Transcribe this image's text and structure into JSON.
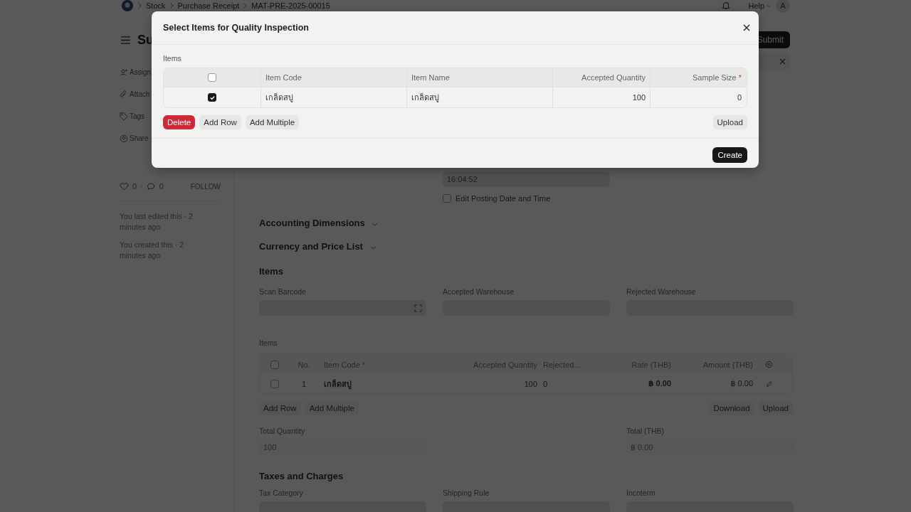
{
  "topbar": {
    "breadcrumbs": [
      "Stock",
      "Purchase Receipt",
      "MAT-PRE-2025-00015"
    ],
    "help": "Help",
    "avatar": "A"
  },
  "header": {
    "title": "Su",
    "submit": "Submit"
  },
  "sidebar": {
    "actions": [
      "Assign",
      "Attach",
      "Tags",
      "Share"
    ],
    "likes": "0",
    "separator": "·",
    "comments": "0",
    "follow": "FOLLOW",
    "activity": [
      "You last edited this · 2 minutes ago",
      "You created this · 2 minutes ago"
    ]
  },
  "form": {
    "posting_time": "16:04:52",
    "edit_posting": {
      "label": "Edit Posting Date and Time",
      "checked": false
    },
    "collapsed_sections": [
      "Accounting Dimensions",
      "Currency and Price List"
    ],
    "items_section": {
      "title": "Items",
      "fields": [
        {
          "label": "Scan Barcode",
          "kind": "barcode"
        },
        {
          "label": "Accepted Warehouse",
          "kind": "link"
        },
        {
          "label": "Rejected Warehouse",
          "kind": "link"
        }
      ],
      "table": {
        "label": "Items",
        "header_checked": false,
        "columns": [
          "No.",
          "Item Code *",
          "Accepted Quantity",
          "Rejected...",
          "Rate (THB)",
          "Amount (THB)"
        ],
        "rows": [
          {
            "checked": false,
            "cells": [
              "1",
              "เกล็ดสบู่",
              "100",
              "0",
              "฿ 0.00",
              "฿ 0.00"
            ]
          }
        ]
      },
      "buttons_left": [
        "Add Row",
        "Add Multiple"
      ],
      "buttons_right": [
        "Download",
        "Upload"
      ],
      "totals": [
        {
          "label": "Total Quantity",
          "value": "100"
        },
        {
          "label": "Total (THB)",
          "value": "฿ 0.00"
        }
      ]
    },
    "taxes_section": {
      "title": "Taxes and Charges",
      "fields": [
        "Tax Category",
        "Shipping Rule",
        "Incoterm"
      ]
    }
  },
  "dialog": {
    "title": "Select Items for Quality Inspection",
    "section_label": "Items",
    "columns": [
      {
        "label": "Item Code",
        "required": false
      },
      {
        "label": "Item Name",
        "required": false
      },
      {
        "label": "Accepted Quantity",
        "required": false
      },
      {
        "label": "Sample Size",
        "required": true
      }
    ],
    "header_checked": false,
    "required_mark": "*",
    "rows": [
      {
        "checked": true,
        "cells": [
          "เกล็ดสบู่",
          "เกล็ดสบู่",
          "100",
          "0"
        ]
      }
    ],
    "delete": "Delete",
    "buttons_left": [
      "Add Row",
      "Add Multiple"
    ],
    "upload": "Upload",
    "primary": "Create"
  }
}
